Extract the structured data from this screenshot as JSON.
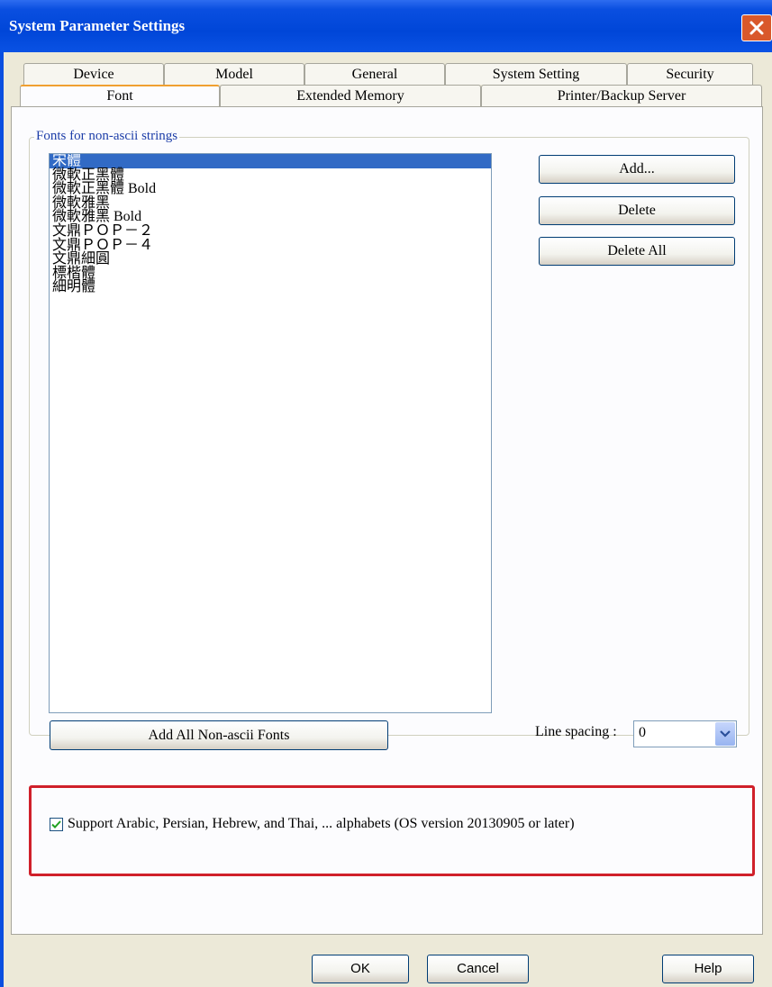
{
  "window": {
    "title": "System Parameter Settings"
  },
  "tabs": {
    "row1": [
      "Device",
      "Model",
      "General",
      "System Setting",
      "Security"
    ],
    "row2": [
      "Font",
      "Extended Memory",
      "Printer/Backup Server"
    ],
    "active": "Font"
  },
  "font_group": {
    "legend": "Fonts for non-ascii strings",
    "items": [
      "宋體",
      "微軟正黑體",
      "微軟正黑體 Bold",
      "微軟雅黑",
      "微軟雅黑 Bold",
      "文鼎ＰＯＰ－２",
      "文鼎ＰＯＰ－４",
      "文鼎細圓",
      "標楷體",
      "細明體"
    ],
    "selected_index": 0,
    "add_label": "Add...",
    "delete_label": "Delete",
    "delete_all_label": "Delete All",
    "add_all_label": "Add All Non-ascii Fonts",
    "line_spacing_label": "Line spacing :",
    "line_spacing_value": "0"
  },
  "support_option": {
    "label": "Support Arabic, Persian, Hebrew, and Thai, ... alphabets (OS version 20130905 or later)",
    "checked": true
  },
  "footer": {
    "ok_label": "OK",
    "cancel_label": "Cancel",
    "help_label": "Help"
  },
  "colors": {
    "title_bar": "#0a4fe0",
    "selection": "#316ac5",
    "highlight_box": "#d0202a"
  },
  "icons": [
    "close-icon",
    "chevron-down-icon",
    "checkmark-icon"
  ]
}
